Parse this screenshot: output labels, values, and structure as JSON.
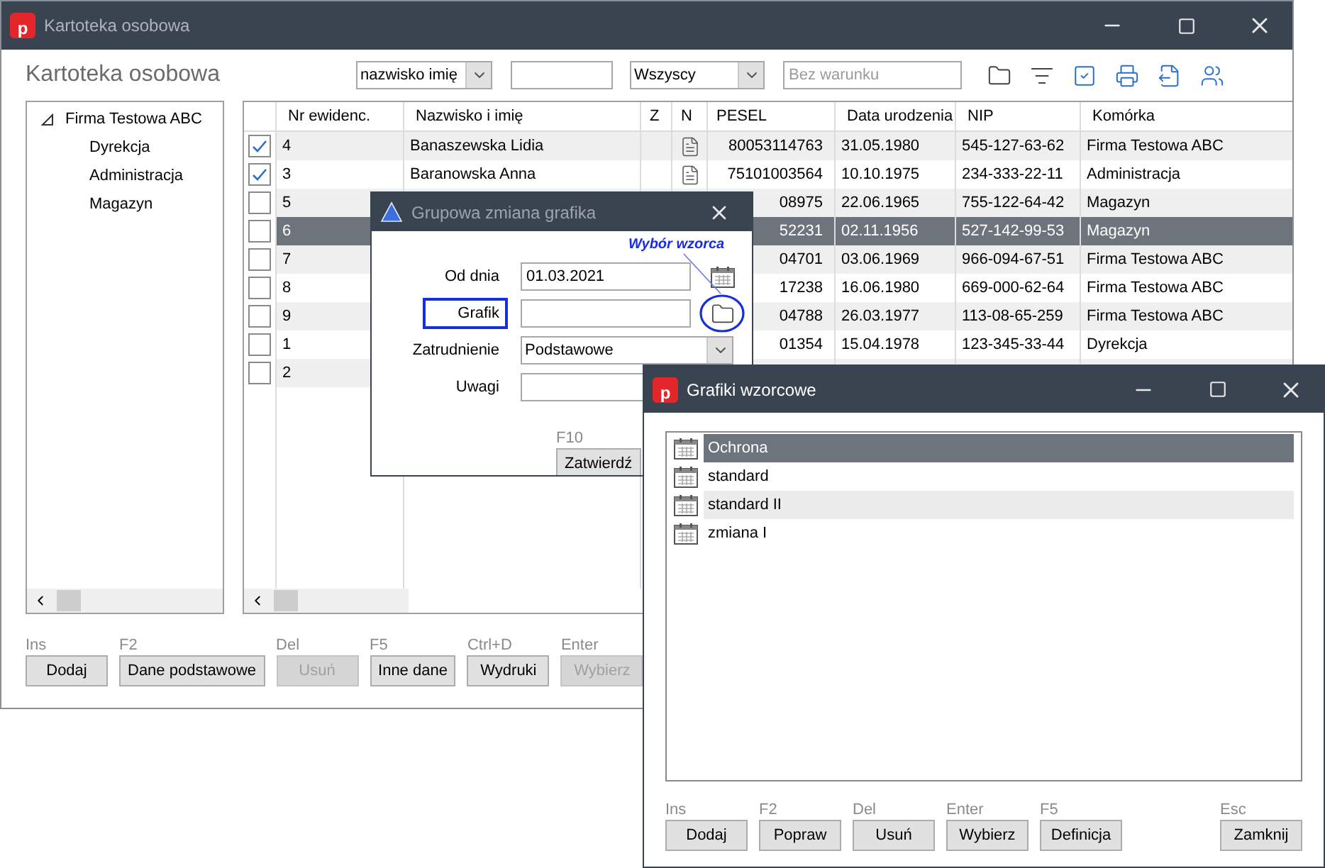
{
  "main_window": {
    "logo": "p",
    "title": "Kartoteka osobowa",
    "heading": "Kartoteka osobowa",
    "filters": {
      "sort_select": "nazwisko imię",
      "scope_select": "Wszyscy",
      "condition_placeholder": "Bez warunku"
    },
    "tree": [
      {
        "label": "Firma Testowa ABC",
        "expanded": true,
        "children": [
          {
            "label": "Dyrekcja"
          },
          {
            "label": "Administracja"
          },
          {
            "label": "Magazyn"
          }
        ]
      }
    ],
    "table": {
      "columns": [
        "Nr ewidenc.",
        "Nazwisko i imię",
        "Z",
        "N",
        "PESEL",
        "Data urodzenia",
        "NIP",
        "Komórka"
      ],
      "rows": [
        {
          "checked": true,
          "selected": false,
          "nr": "4",
          "name": "Banaszewska Lidia",
          "note": true,
          "pesel": "80053114763",
          "birth": "31.05.1980",
          "nip": "545-127-63-62",
          "unit": "Firma Testowa ABC"
        },
        {
          "checked": true,
          "selected": false,
          "nr": "3",
          "name": "Baranowska Anna",
          "note": true,
          "pesel": "75101003564",
          "birth": "10.10.1975",
          "nip": "234-333-22-11",
          "unit": "Administracja"
        },
        {
          "checked": false,
          "selected": false,
          "nr": "5",
          "pesel": "08975",
          "birth": "22.06.1965",
          "nip": "755-122-64-42",
          "unit": "Magazyn"
        },
        {
          "checked": false,
          "selected": true,
          "nr": "6",
          "pesel": "52231",
          "birth": "02.11.1956",
          "nip": "527-142-99-53",
          "unit": "Magazyn"
        },
        {
          "checked": false,
          "selected": false,
          "nr": "7",
          "pesel": "04701",
          "birth": "03.06.1969",
          "nip": "966-094-67-51",
          "unit": "Firma Testowa ABC"
        },
        {
          "checked": false,
          "selected": false,
          "nr": "8",
          "pesel": "17238",
          "birth": "16.06.1980",
          "nip": "669-000-62-64",
          "unit": "Firma Testowa ABC"
        },
        {
          "checked": false,
          "selected": false,
          "nr": "9",
          "pesel": "04788",
          "birth": "26.03.1977",
          "nip": "113-08-65-259",
          "unit": "Firma Testowa ABC"
        },
        {
          "checked": false,
          "selected": false,
          "nr": "1",
          "pesel": "01354",
          "birth": "15.04.1978",
          "nip": "123-345-33-44",
          "unit": "Dyrekcja"
        },
        {
          "checked": false,
          "selected": false,
          "nr": "2"
        }
      ]
    },
    "buttons": [
      {
        "key": "Ins",
        "label": "Dodaj",
        "disabled": false
      },
      {
        "key": "F2",
        "label": "Dane podstawowe",
        "disabled": false
      },
      {
        "key": "Del",
        "label": "Usuń",
        "disabled": true
      },
      {
        "key": "F5",
        "label": "Inne dane",
        "disabled": false
      },
      {
        "key": "Ctrl+D",
        "label": "Wydruki",
        "disabled": false
      },
      {
        "key": "Enter",
        "label": "Wybierz",
        "disabled": true
      }
    ]
  },
  "dialog": {
    "title": "Grupowa zmiana grafika",
    "fields": [
      {
        "kind": "date",
        "label": "Od dnia",
        "value": "01.03.2021",
        "highlighted": false
      },
      {
        "kind": "picker",
        "label": "Grafik",
        "highlighted": true
      },
      {
        "kind": "select",
        "label": "Zatrudnienie",
        "value": "Podstawowe",
        "highlighted": false
      },
      {
        "kind": "text",
        "label": "Uwagi",
        "highlighted": false
      }
    ],
    "annotation": "Wybór wzorca",
    "confirm": {
      "key": "F10",
      "label": "Zatwierdź"
    }
  },
  "templates_window": {
    "logo": "p",
    "title": "Grafiki wzorcowe",
    "items": [
      {
        "label": "Ochrona",
        "selected": true
      },
      {
        "label": "standard",
        "selected": false
      },
      {
        "label": "standard II",
        "selected": false
      },
      {
        "label": "zmiana I",
        "selected": false
      }
    ],
    "buttons": [
      {
        "key": "Ins",
        "label": "Dodaj"
      },
      {
        "key": "F2",
        "label": "Popraw"
      },
      {
        "key": "Del",
        "label": "Usuń"
      },
      {
        "key": "Enter",
        "label": "Wybierz"
      },
      {
        "key": "F5",
        "label": "Definicja"
      },
      {
        "key": "Esc",
        "label": "Zamknij",
        "kind": "close"
      }
    ]
  }
}
